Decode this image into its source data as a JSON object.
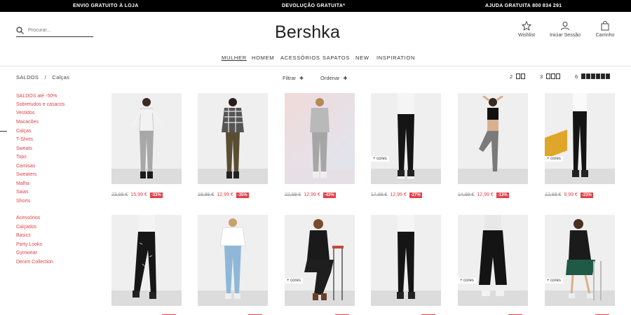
{
  "topbar": {
    "shipping": "ENVIO GRATUITO À LOJA",
    "returns": "DEVOLUÇÃO GRATUITA*",
    "help": "AJUDA GRATUITA 800 834 291"
  },
  "header": {
    "search_placeholder": "Procurar...",
    "logo": "Bershka",
    "wishlist": "Wishlist",
    "login": "Iniciar Sessão",
    "cart": "Carrinho"
  },
  "nav": [
    "MULHER",
    "HOMEM",
    "ACESSÓRIOS",
    "SAPATOS",
    "NEW",
    "INSPIRATION"
  ],
  "breadcrumb": {
    "parent": "SALDOS",
    "sep": "/",
    "current": "Calças"
  },
  "filters": {
    "filter": "Filtrar",
    "sort": "Ordenar",
    "plus": "+"
  },
  "grid_options": [
    "2",
    "3",
    "6"
  ],
  "sidebar": {
    "group1": [
      "SALDOS até -50%",
      "Sobretudos e casacos",
      "Vestidos",
      "Macacões",
      "Calças",
      "T-Shirts",
      "Sweats",
      "Tops",
      "Camisas",
      "Sweaters",
      "Malha",
      "Saias",
      "Shorts"
    ],
    "group2": [
      "Acessórios",
      "Calçados",
      "Basics",
      "Party Looks",
      "Gymwear",
      "Denim Collection"
    ]
  },
  "products_row1": [
    {
      "old": "23,99 €",
      "new": "15,99 €",
      "discount": "-33%",
      "cores": ""
    },
    {
      "old": "19,99 €",
      "new": "12,99 €",
      "discount": "-35%",
      "cores": ""
    },
    {
      "old": "22,99 €",
      "new": "12,99 €",
      "discount": "-43%",
      "cores": ""
    },
    {
      "old": "17,99 €",
      "new": "12,99 €",
      "discount": "-27%",
      "cores": "+ cores"
    },
    {
      "old": "14,99 €",
      "new": "12,99 €",
      "discount": "-13%",
      "cores": ""
    },
    {
      "old": "12,99 €",
      "new": "9,99 €",
      "discount": "-23%",
      "cores": "+ cores"
    }
  ],
  "products_row2_cores": [
    "",
    "",
    "+ cores",
    "",
    "+ cores",
    "+ cores"
  ],
  "colors": {
    "accent": "#e0424a",
    "topbar": "#000000"
  }
}
